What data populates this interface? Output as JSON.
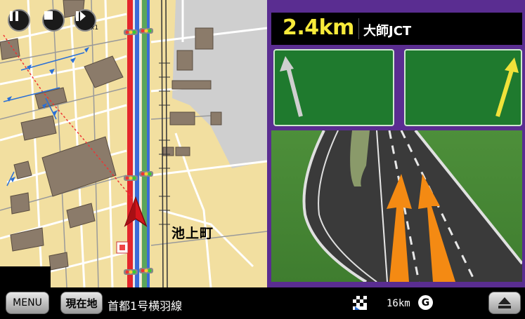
{
  "map": {
    "place_name": "池上町",
    "speed_label": "x1",
    "controls": {
      "pause": "pause-icon",
      "stop": "stop-icon",
      "fast_forward": "fast-forward-icon"
    }
  },
  "junction": {
    "distance": "2.4km",
    "name": "大師JCT"
  },
  "bottom_bar": {
    "menu_label": "MENU",
    "current_location_label": "現在地",
    "road_name": "首都1号横羽線",
    "remaining_distance": "16km",
    "goal_label": "G"
  },
  "colors": {
    "route_red": "#e3262b",
    "route_blue": "#3a6bd6",
    "junction_frame": "#5a2d91",
    "distance_yellow": "#f7ea3a",
    "sign_green": "#1f7a2e"
  }
}
